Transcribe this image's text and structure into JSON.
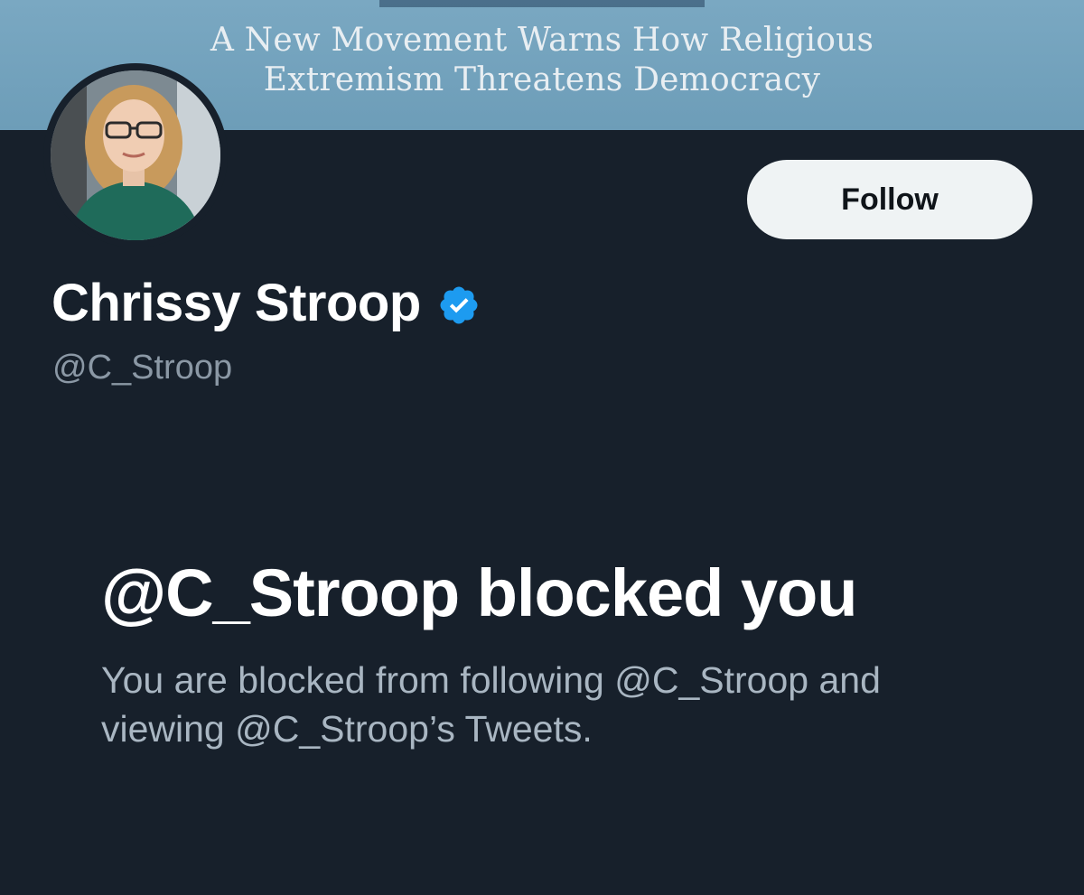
{
  "banner": {
    "subtitle_line_1": "A New Movement Warns How Religious",
    "subtitle_line_2": "Extremism Threatens Democracy"
  },
  "profile": {
    "display_name": "Chrissy Stroop",
    "handle": "@C_Stroop",
    "verified": true,
    "verified_icon": "verified-badge-icon",
    "follow_label": "Follow"
  },
  "blocked_notice": {
    "title": "@C_Stroop blocked you",
    "body": "You are blocked from following @C_Stroop and viewing @C_Stroop’s Tweets."
  },
  "colors": {
    "background": "#17202b",
    "banner": "#6d9db8",
    "verified_blue": "#1d9bf0",
    "follow_button_bg": "#eff3f4",
    "secondary_text": "#8b98a5"
  }
}
